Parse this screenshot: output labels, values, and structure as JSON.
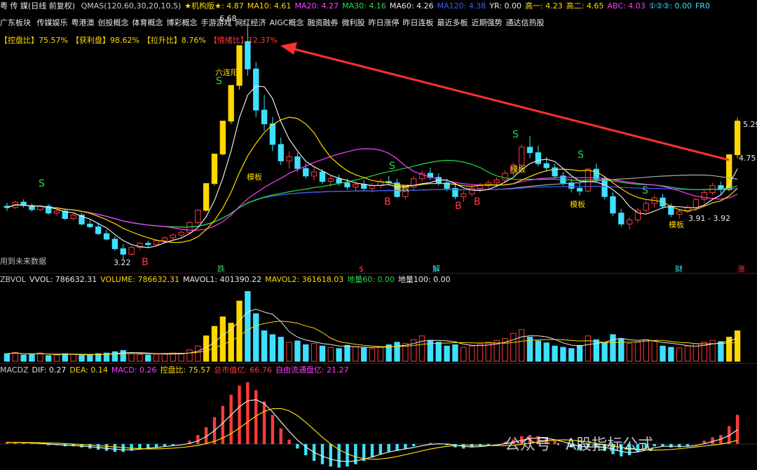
{
  "header": {
    "title": "粤 传 媒(日线 前复权)",
    "items": [
      {
        "text": "QMAS(120,60,30,20,10,5)",
        "color": "#cccccc"
      },
      {
        "text": "★机构版★: 4.87",
        "color": "#ffd800"
      },
      {
        "text": "MA10: 4.61",
        "color": "#ffd800"
      },
      {
        "text": "MA20: 4.27",
        "color": "#ff3cff"
      },
      {
        "text": "MA30: 4.16",
        "color": "#27d94a"
      },
      {
        "text": "MA60: 4.26",
        "color": "#e8e8e8"
      },
      {
        "text": "MA120: 4.38",
        "color": "#3c5cff"
      },
      {
        "text": "YR: 0.00",
        "color": "#e8e8e8"
      },
      {
        "text": "高一: 4.23",
        "color": "#ffd800"
      },
      {
        "text": "高二: 4.65",
        "color": "#ffd800"
      },
      {
        "text": "ABC: 4.03",
        "color": "#ff3cff"
      },
      {
        "text": "①②③: 0.00",
        "color": "#3fe0ff"
      },
      {
        "text": "FR0",
        "color": "#3fe0ff"
      }
    ]
  },
  "concepts": {
    "label": "广东板块",
    "items": [
      "传媒娱乐",
      "粤港澳",
      "创投概念",
      "体育概念",
      "博彩概念",
      "手游游戏",
      "网红经济",
      "AIGC概念",
      "融资融券",
      "微利股",
      "昨日涨停",
      "昨日连板",
      "最近多板",
      "近期强势",
      "通达信热股"
    ]
  },
  "ratios": [
    {
      "text": "【控盘比】75.57%",
      "color": "#ffd800"
    },
    {
      "text": "【获利盘】98.62%",
      "color": "#ffd800"
    },
    {
      "text": "【拉升比】8.76%",
      "color": "#ffd800"
    },
    {
      "text": "【情绪比】12.37%",
      "color": "#ff3b3b"
    }
  ],
  "footnote": "用到未来数据",
  "volume_header": [
    {
      "text": "ZBVOL",
      "color": "#cccccc"
    },
    {
      "text": "VVOL: 786632.31",
      "color": "#e8e8e8"
    },
    {
      "text": "VOLUME: 786632.31",
      "color": "#ffd800"
    },
    {
      "text": "MAVOL1: 401390.22",
      "color": "#e8e8e8"
    },
    {
      "text": "MAVOL2: 361618.03",
      "color": "#ffd800"
    },
    {
      "text": "地量60: 0.00",
      "color": "#27d94a"
    },
    {
      "text": "地量100: 0.00",
      "color": "#e8e8e8"
    }
  ],
  "macd_header": [
    {
      "text": "MACDZ",
      "color": "#cccccc"
    },
    {
      "text": "DIF: 0.27",
      "color": "#e8e8e8"
    },
    {
      "text": "DEA: 0.14",
      "color": "#ffd800"
    },
    {
      "text": "MACD: 0.26",
      "color": "#ff3cff"
    },
    {
      "text": "控盘比: 75.57",
      "color": "#ffd800"
    },
    {
      "text": "总市值亿: 66.76",
      "color": "#ff3b3b"
    },
    {
      "text": "自由流通盘亿: 21.27",
      "color": "#ff3cff"
    }
  ],
  "watermark": "公众号 · A股指标公式",
  "chart_data": {
    "type": "candlestick",
    "price_labels": [
      "6.68",
      "3.22",
      "3.91 - 3.92",
      "4.75",
      "5.29"
    ],
    "annotations": [
      "六连阳",
      "模板",
      "模板",
      "模板",
      "模板",
      "模板"
    ],
    "event_markers": [
      "跌",
      "$",
      "解",
      "财",
      "涨"
    ],
    "signal_labels": {
      "sell": "S",
      "buy": "B"
    },
    "colors": {
      "up": "#ff3b3b",
      "down": "#3fe0ff",
      "limit_up": "#ffd800",
      "ma5": "#e8e8e8",
      "ma10": "#ffd800",
      "ma20": "#ff3cff",
      "ma30": "#27d94a",
      "ma60": "#aaaaaa",
      "ma120": "#3c5cff"
    },
    "candles": [
      [
        4.0,
        4.05,
        3.93,
        3.98
      ],
      [
        3.98,
        4.08,
        3.96,
        4.06
      ],
      [
        4.06,
        4.1,
        3.98,
        4.01
      ],
      [
        4.01,
        4.04,
        3.92,
        3.95
      ],
      [
        3.95,
        4.02,
        3.93,
        4.0
      ],
      [
        4.0,
        4.03,
        3.88,
        3.9
      ],
      [
        3.9,
        3.96,
        3.86,
        3.93
      ],
      [
        3.93,
        3.95,
        3.8,
        3.82
      ],
      [
        3.82,
        3.9,
        3.79,
        3.87
      ],
      [
        3.87,
        3.9,
        3.72,
        3.74
      ],
      [
        3.74,
        3.8,
        3.68,
        3.7
      ],
      [
        3.7,
        3.76,
        3.58,
        3.6
      ],
      [
        3.6,
        3.66,
        3.5,
        3.52
      ],
      [
        3.52,
        3.56,
        3.35,
        3.38
      ],
      [
        3.38,
        3.45,
        3.22,
        3.3
      ],
      [
        3.3,
        3.42,
        3.28,
        3.4
      ],
      [
        3.4,
        3.48,
        3.36,
        3.46
      ],
      [
        3.46,
        3.5,
        3.4,
        3.44
      ],
      [
        3.44,
        3.52,
        3.42,
        3.5
      ],
      [
        3.5,
        3.56,
        3.46,
        3.54
      ],
      [
        3.54,
        3.6,
        3.5,
        3.58
      ],
      [
        3.58,
        3.64,
        3.54,
        3.62
      ],
      [
        3.62,
        3.78,
        3.6,
        3.76
      ],
      [
        3.76,
        3.96,
        3.74,
        3.94
      ],
      [
        3.94,
        4.33,
        3.92,
        4.33
      ],
      [
        4.33,
        4.76,
        4.3,
        4.76
      ],
      [
        4.76,
        5.24,
        4.74,
        5.24
      ],
      [
        5.24,
        5.76,
        5.2,
        5.76
      ],
      [
        5.76,
        6.34,
        5.7,
        6.34
      ],
      [
        6.4,
        6.68,
        5.9,
        6.0
      ],
      [
        6.0,
        6.1,
        5.3,
        5.4
      ],
      [
        5.4,
        5.62,
        5.1,
        5.2
      ],
      [
        5.2,
        5.3,
        4.8,
        4.9
      ],
      [
        4.9,
        5.0,
        4.6,
        4.66
      ],
      [
        4.66,
        4.8,
        4.55,
        4.72
      ],
      [
        4.72,
        4.78,
        4.5,
        4.55
      ],
      [
        4.55,
        4.62,
        4.4,
        4.44
      ],
      [
        4.44,
        4.56,
        4.38,
        4.5
      ],
      [
        4.5,
        4.54,
        4.32,
        4.36
      ],
      [
        4.36,
        4.44,
        4.28,
        4.4
      ],
      [
        4.4,
        4.46,
        4.3,
        4.34
      ],
      [
        4.34,
        4.4,
        4.24,
        4.28
      ],
      [
        4.28,
        4.36,
        4.22,
        4.32
      ],
      [
        4.32,
        4.38,
        4.22,
        4.26
      ],
      [
        4.26,
        4.34,
        4.2,
        4.3
      ],
      [
        4.3,
        4.4,
        4.26,
        4.36
      ],
      [
        4.36,
        4.44,
        4.3,
        4.34
      ],
      [
        4.34,
        4.4,
        4.12,
        4.14
      ],
      [
        4.14,
        4.3,
        4.1,
        4.28
      ],
      [
        4.28,
        4.44,
        4.24,
        4.4
      ],
      [
        4.4,
        4.52,
        4.36,
        4.48
      ],
      [
        4.48,
        4.56,
        4.38,
        4.42
      ],
      [
        4.42,
        4.48,
        4.3,
        4.34
      ],
      [
        4.34,
        4.4,
        4.22,
        4.26
      ],
      [
        4.26,
        4.34,
        4.1,
        4.14
      ],
      [
        4.14,
        4.22,
        4.06,
        4.18
      ],
      [
        4.18,
        4.3,
        4.14,
        4.26
      ],
      [
        4.26,
        4.34,
        4.2,
        4.3
      ],
      [
        4.3,
        4.38,
        4.24,
        4.34
      ],
      [
        4.34,
        4.42,
        4.28,
        4.38
      ],
      [
        4.38,
        4.52,
        4.34,
        4.48
      ],
      [
        4.48,
        4.64,
        4.44,
        4.6
      ],
      [
        4.6,
        4.9,
        4.56,
        4.86
      ],
      [
        4.86,
        5.02,
        4.7,
        4.78
      ],
      [
        4.78,
        4.88,
        4.58,
        4.62
      ],
      [
        4.62,
        4.72,
        4.5,
        4.56
      ],
      [
        4.56,
        4.62,
        4.4,
        4.44
      ],
      [
        4.44,
        4.5,
        4.3,
        4.34
      ],
      [
        4.34,
        4.4,
        4.2,
        4.26
      ],
      [
        4.26,
        4.34,
        4.16,
        4.22
      ],
      [
        4.22,
        4.56,
        4.2,
        4.54
      ],
      [
        4.54,
        4.62,
        4.36,
        4.4
      ],
      [
        4.4,
        4.44,
        4.1,
        4.14
      ],
      [
        4.14,
        4.2,
        3.86,
        3.9
      ],
      [
        3.9,
        3.96,
        3.7,
        3.74
      ],
      [
        3.74,
        3.84,
        3.66,
        3.8
      ],
      [
        3.8,
        3.98,
        3.76,
        3.94
      ],
      [
        3.94,
        4.08,
        3.9,
        4.04
      ],
      [
        4.04,
        4.16,
        3.98,
        4.12
      ],
      [
        4.12,
        4.18,
        3.96,
        4.0
      ],
      [
        4.0,
        4.04,
        3.84,
        3.88
      ],
      [
        3.88,
        3.96,
        3.82,
        3.92
      ],
      [
        3.92,
        4.02,
        3.9,
        3.98
      ],
      [
        3.98,
        4.12,
        3.94,
        4.1
      ],
      [
        4.1,
        4.24,
        4.06,
        4.2
      ],
      [
        4.2,
        4.34,
        4.16,
        4.3
      ],
      [
        4.3,
        4.36,
        4.18,
        4.24
      ],
      [
        4.24,
        4.75,
        4.22,
        4.75
      ],
      [
        4.75,
        5.29,
        4.7,
        5.24
      ]
    ],
    "volume": [
      12,
      14,
      10,
      11,
      13,
      9,
      10,
      12,
      11,
      9,
      10,
      12,
      13,
      15,
      17,
      12,
      11,
      10,
      11,
      12,
      13,
      12,
      18,
      24,
      40,
      55,
      70,
      60,
      95,
      110,
      75,
      48,
      42,
      38,
      30,
      32,
      26,
      28,
      24,
      22,
      20,
      25,
      23,
      21,
      20,
      22,
      26,
      30,
      28,
      34,
      40,
      33,
      30,
      24,
      26,
      22,
      24,
      27,
      30,
      33,
      36,
      44,
      50,
      38,
      32,
      29,
      24,
      22,
      20,
      25,
      40,
      34,
      30,
      42,
      35,
      28,
      30,
      34,
      32,
      24,
      22,
      21,
      24,
      28,
      30,
      33,
      31,
      38,
      48
    ],
    "macd": [
      0.02,
      0.02,
      0.01,
      0.01,
      0.0,
      -0.01,
      -0.01,
      -0.02,
      -0.02,
      -0.03,
      -0.04,
      -0.05,
      -0.06,
      -0.07,
      -0.07,
      -0.06,
      -0.05,
      -0.04,
      -0.03,
      -0.02,
      -0.01,
      0.0,
      0.03,
      0.08,
      0.15,
      0.24,
      0.34,
      0.44,
      0.52,
      0.55,
      0.48,
      0.38,
      0.26,
      0.14,
      0.04,
      -0.04,
      -0.1,
      -0.15,
      -0.18,
      -0.2,
      -0.21,
      -0.2,
      -0.18,
      -0.15,
      -0.12,
      -0.09,
      -0.07,
      -0.06,
      -0.04,
      -0.02,
      0.0,
      0.01,
      0.0,
      -0.01,
      -0.03,
      -0.04,
      -0.03,
      -0.02,
      -0.01,
      0.0,
      0.02,
      0.04,
      0.07,
      0.08,
      0.07,
      0.05,
      0.03,
      0.0,
      -0.03,
      -0.05,
      -0.02,
      -0.03,
      -0.06,
      -0.09,
      -0.11,
      -0.1,
      -0.07,
      -0.04,
      -0.02,
      -0.02,
      -0.03,
      -0.03,
      -0.02,
      0.0,
      0.03,
      0.06,
      0.08,
      0.16,
      0.26
    ]
  }
}
